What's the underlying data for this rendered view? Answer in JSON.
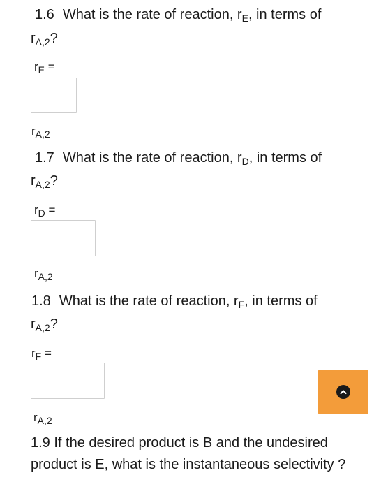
{
  "q16": {
    "number": "1.6",
    "text_a": "What is the rate of reaction, r",
    "sub_a": "E",
    "text_b": ", in terms of",
    "cont_r": "r",
    "cont_sub": "A,2",
    "cont_end": "?",
    "label_r": "r",
    "label_sub": "E",
    "label_eq": " =",
    "unit_r": "r",
    "unit_sub": "A,2"
  },
  "q17": {
    "number": "1.7",
    "text_a": "What is the rate of reaction, r",
    "sub_a": "D",
    "text_b": ", in terms of",
    "cont_r": "r",
    "cont_sub": "A,2",
    "cont_end": "?",
    "label_r": "r",
    "label_sub": "D",
    "label_eq": " =",
    "unit_r": "r",
    "unit_sub": "A,2"
  },
  "q18": {
    "number": "1.8",
    "text_a": "What is the rate of reaction, r",
    "sub_a": "F",
    "text_b": ", in terms of",
    "cont_r": "r",
    "cont_sub": "A,2",
    "cont_end": "?",
    "label_r": "r",
    "label_sub": "F",
    "label_eq": " =",
    "unit_r": "r",
    "unit_sub": "A,2"
  },
  "q19": {
    "number": "1.9",
    "text": "If the desired product is B and the undesired product is E, what is the instantaneous selectivity ?"
  },
  "scroll_button": {
    "icon": "chevron-up-icon",
    "color": "#f39c3a"
  }
}
